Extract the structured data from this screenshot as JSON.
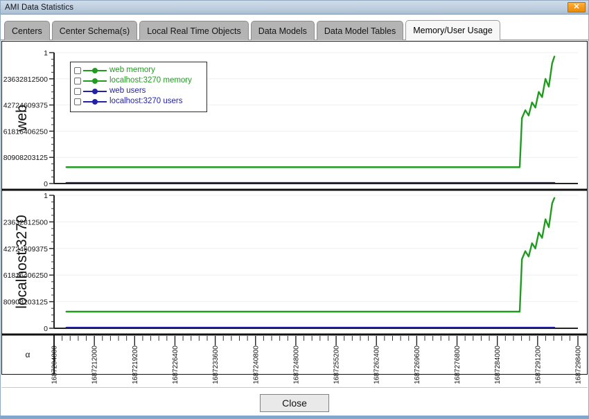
{
  "window": {
    "title": "AMI Data Statistics",
    "close_icon": "close-x-icon",
    "close_glyph": "✕"
  },
  "tabs": [
    {
      "label": "Centers",
      "active": false
    },
    {
      "label": "Center Schema(s)",
      "active": false
    },
    {
      "label": "Local Real Time Objects",
      "active": false
    },
    {
      "label": "Data Models",
      "active": false
    },
    {
      "label": "Data Model Tables",
      "active": false
    },
    {
      "label": "Memory/User Usage",
      "active": true
    }
  ],
  "legend": {
    "items": [
      {
        "label": "web memory",
        "color": "#1f9c1f",
        "checked": false
      },
      {
        "label": "localhost:3270 memory",
        "color": "#1f9c1f",
        "checked": false
      },
      {
        "label": "web users",
        "color": "#2222a8",
        "checked": false
      },
      {
        "label": "localhost:3270 users",
        "color": "#2222a8",
        "checked": false
      }
    ]
  },
  "footer": {
    "close_label": "Close"
  },
  "colors": {
    "memory_green": "#1f9c1f",
    "users_blue": "#2222a8",
    "grid": "#eeeeee",
    "axis": "#000000",
    "titlebar": "#bfcfe0",
    "close_orange": "#f79a17",
    "tab_inactive": "#b4b4b4",
    "tab_active": "#f7f7f7"
  },
  "chart_data": [
    {
      "type": "line",
      "title": "web",
      "ylabel": "web",
      "xlabel": "",
      "grid": true,
      "legend_position": "top-left-inside",
      "ylim": [
        0,
        1
      ],
      "yticks": [
        0,
        0.2,
        0.4,
        0.6,
        0.8,
        1
      ],
      "ytick_labels": [
        "0",
        "80908203125",
        "61816406250",
        "42724609375",
        "23632812500",
        "1"
      ],
      "xlim": [
        1687204800,
        1687298400
      ],
      "series": [
        {
          "name": "web memory",
          "color": "#1f9c1f",
          "x": [
            1687207000,
            1687240000,
            1687260000,
            1687280000,
            1687288000,
            1687288400,
            1687289000,
            1687289600,
            1687290200,
            1687290800,
            1687291400,
            1687292000,
            1687292600,
            1687293200,
            1687293800,
            1687294200
          ],
          "y": [
            0.125,
            0.125,
            0.125,
            0.125,
            0.125,
            0.5,
            0.56,
            0.52,
            0.62,
            0.58,
            0.7,
            0.66,
            0.8,
            0.74,
            0.92,
            0.97
          ]
        },
        {
          "name": "web users",
          "color": "#2222a8",
          "x": [
            1687207000,
            1687250000,
            1687294200
          ],
          "y": [
            0.005,
            0.005,
            0.005
          ]
        }
      ]
    },
    {
      "type": "line",
      "title": "localhost:3270",
      "ylabel": "localhost:3270",
      "xlabel": "α",
      "grid": true,
      "ylim": [
        0,
        1
      ],
      "yticks": [
        0,
        0.2,
        0.4,
        0.6,
        0.8,
        1
      ],
      "ytick_labels": [
        "0",
        "80908203125",
        "61816406250",
        "42724609375",
        "23632812500",
        "1"
      ],
      "xlim": [
        1687204800,
        1687298400
      ],
      "xticks": [
        1687204800,
        1687212000,
        1687219200,
        1687226400,
        1687233600,
        1687240800,
        1687248000,
        1687255200,
        1687262400,
        1687269600,
        1687276800,
        1687284000,
        1687291200,
        1687298400
      ],
      "xtick_labels": [
        "1687204800",
        "1687212000",
        "1687219200",
        "1687226400",
        "1687233600",
        "1687240800",
        "1687248000",
        "1687255200",
        "1687262400",
        "1687269600",
        "1687276800",
        "1687284000",
        "1687291200",
        "1687298400"
      ],
      "series": [
        {
          "name": "localhost:3270 memory",
          "color": "#1f9c1f",
          "x": [
            1687207000,
            1687240000,
            1687260000,
            1687280000,
            1687288000,
            1687288400,
            1687289000,
            1687289600,
            1687290200,
            1687290800,
            1687291400,
            1687292000,
            1687292600,
            1687293200,
            1687293800,
            1687294200
          ],
          "y": [
            0.125,
            0.125,
            0.125,
            0.125,
            0.125,
            0.52,
            0.58,
            0.54,
            0.64,
            0.6,
            0.72,
            0.68,
            0.82,
            0.76,
            0.94,
            0.98
          ]
        },
        {
          "name": "localhost:3270 users",
          "color": "#2222a8",
          "x": [
            1687207000,
            1687250000,
            1687294200
          ],
          "y": [
            0.005,
            0.005,
            0.005
          ]
        }
      ]
    }
  ]
}
